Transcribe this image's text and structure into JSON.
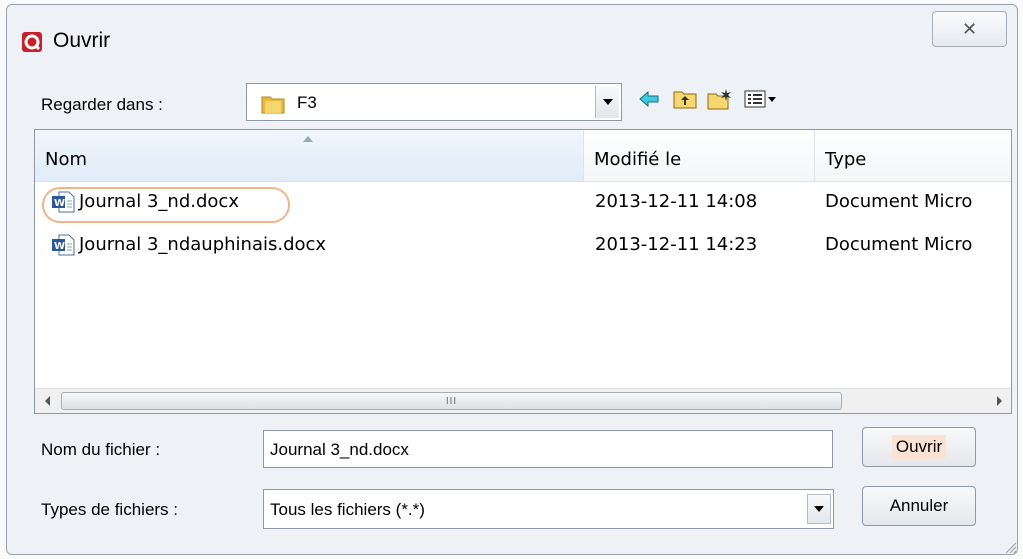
{
  "window": {
    "title": "Ouvrir",
    "close_label": "✕"
  },
  "lookin": {
    "label": "Regarder dans :",
    "value": "F3"
  },
  "filelist": {
    "columns": [
      "Nom",
      "Modifié le",
      "Type"
    ],
    "rows": [
      {
        "name": "Journal 3_nd.docx",
        "modified": "2013-12-11 14:08",
        "type": "Document Micro"
      },
      {
        "name": "Journal 3_ndauphinais.docx",
        "modified": "2013-12-11 14:23",
        "type": "Document Micro"
      }
    ],
    "scroll_grip": "III"
  },
  "filename": {
    "label": "Nom du fichier :",
    "value": "Journal 3_nd.docx"
  },
  "filetype": {
    "label": "Types de fichiers :",
    "value": "Tous les fichiers (*.*)"
  },
  "buttons": {
    "open": "Ouvrir",
    "cancel": "Annuler"
  },
  "colors": {
    "window_bg": "#eef2f7",
    "highlight": "#f0b48a"
  }
}
